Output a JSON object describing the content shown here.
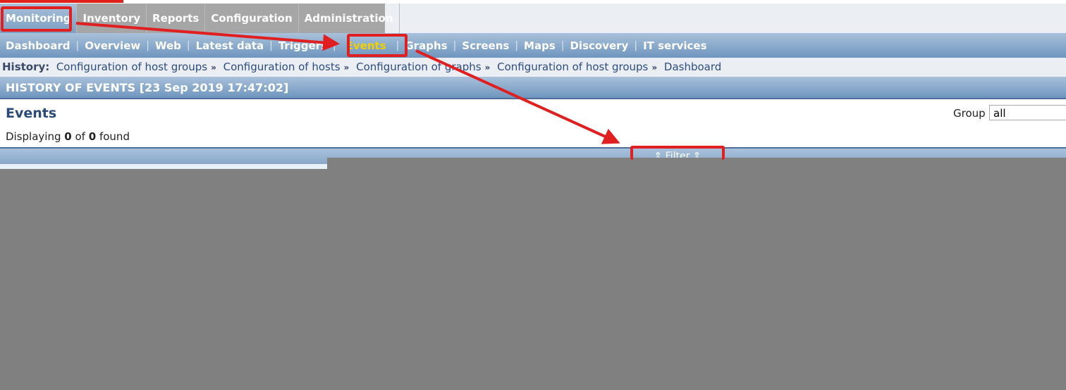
{
  "main_tabs": [
    "Monitoring",
    "Inventory",
    "Reports",
    "Configuration",
    "Administration"
  ],
  "sub_nav": [
    "Dashboard",
    "Overview",
    "Web",
    "Latest data",
    "Triggers",
    "Events",
    "Graphs",
    "Screens",
    "Maps",
    "Discovery",
    "IT services"
  ],
  "history": {
    "label": "History:",
    "items": [
      "Configuration of host groups",
      "Configuration of hosts",
      "Configuration of graphs",
      "Configuration of host groups",
      "Dashboard"
    ],
    "separator": "»"
  },
  "header": "HISTORY OF EVENTS [23 Sep 2019 17:47:02]",
  "page_title": "Events",
  "displaying": {
    "prefix": "Displaying",
    "shown": "0",
    "of": "of",
    "total": "0",
    "suffix": "found"
  },
  "group": {
    "label": "Group",
    "value": "all"
  },
  "filter": {
    "label": "Filter",
    "icon": "double-chevron-up-icon"
  },
  "annotation_color": "#e02020"
}
